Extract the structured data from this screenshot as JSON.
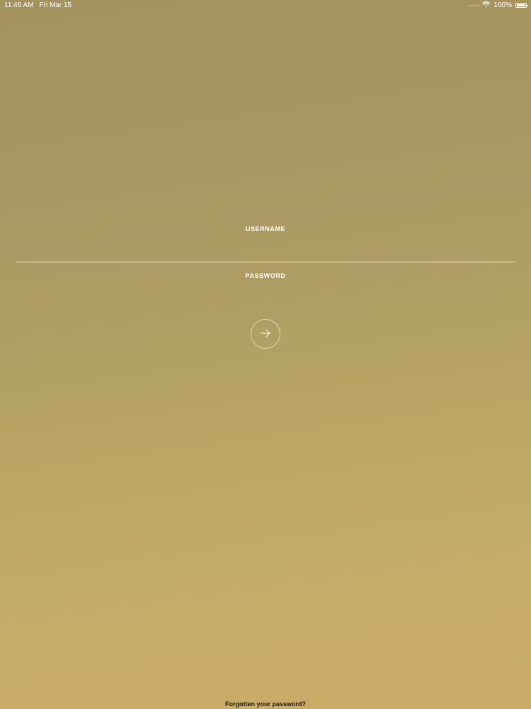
{
  "status_bar": {
    "time": "11:46 AM",
    "date": "Fri Mar 15",
    "battery": "100%",
    "battery_level": 1.0,
    "icons": [
      "cellular-dots-icon",
      "wifi-icon",
      "battery-icon"
    ]
  },
  "login": {
    "username_label": "USERNAME",
    "username_value": "",
    "password_label": "PASSWORD",
    "password_value": "",
    "submit_icon": "arrow-right-icon",
    "forgot_password": "Forgotten your password?"
  },
  "colors": {
    "background_top": "#a4925f",
    "background_bottom": "#cbac68",
    "text": "#ffffff",
    "link_text": "#1c1a14"
  }
}
